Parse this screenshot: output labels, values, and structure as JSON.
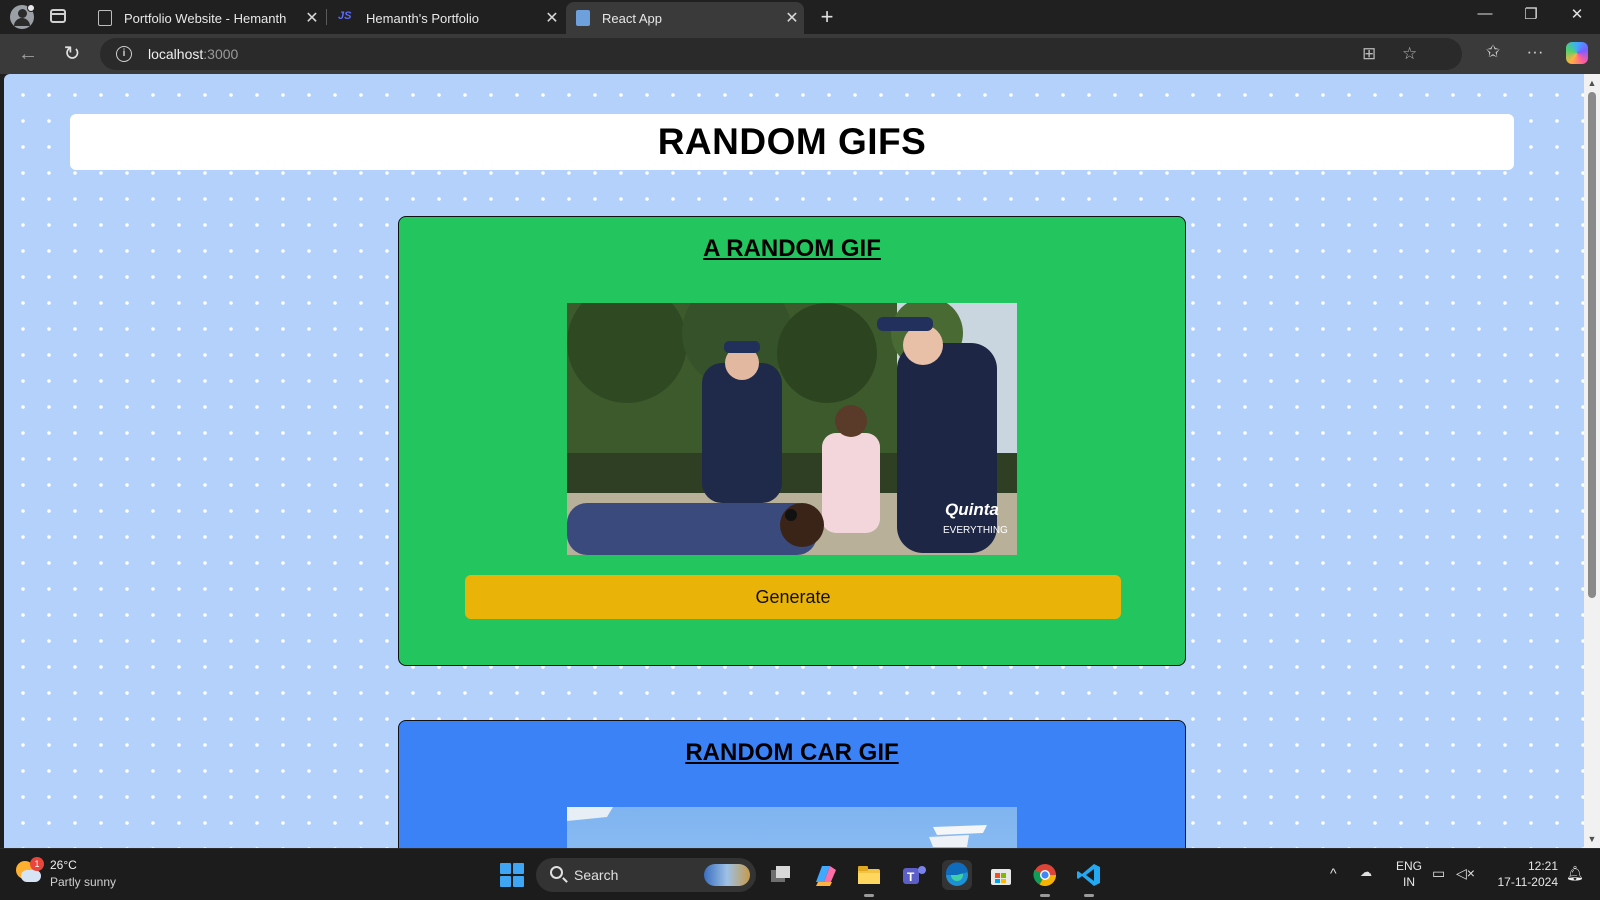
{
  "browser": {
    "tabs": [
      {
        "title": "Portfolio Website - Hemanth",
        "icon": "document-icon"
      },
      {
        "title": "Hemanth's Portfolio",
        "icon": "js-icon"
      },
      {
        "title": "React App",
        "icon": "react-doc-icon",
        "active": true
      }
    ],
    "new_tab": "+",
    "close_glyph": "✕",
    "url_host": "localhost",
    "url_port": ":3000"
  },
  "page": {
    "title": "RANDOM GIFS",
    "cards": [
      {
        "heading": "A RANDOM GIF",
        "button": "Generate",
        "color": "#22c55e"
      },
      {
        "heading": "RANDOM CAR GIF",
        "color": "#3b82f6"
      }
    ],
    "gif_watermark": "Quinta",
    "gif_watermark_sub": "EVERYTHING"
  },
  "taskbar": {
    "weather_badge": "1",
    "temperature": "26°C",
    "condition": "Partly sunny",
    "search_label": "Search",
    "lang_1": "ENG",
    "lang_2": "IN",
    "time": "12:21",
    "date": "17-11-2024"
  },
  "colors": {
    "page_bg": "#b3d1fb",
    "button": "#eab308"
  }
}
